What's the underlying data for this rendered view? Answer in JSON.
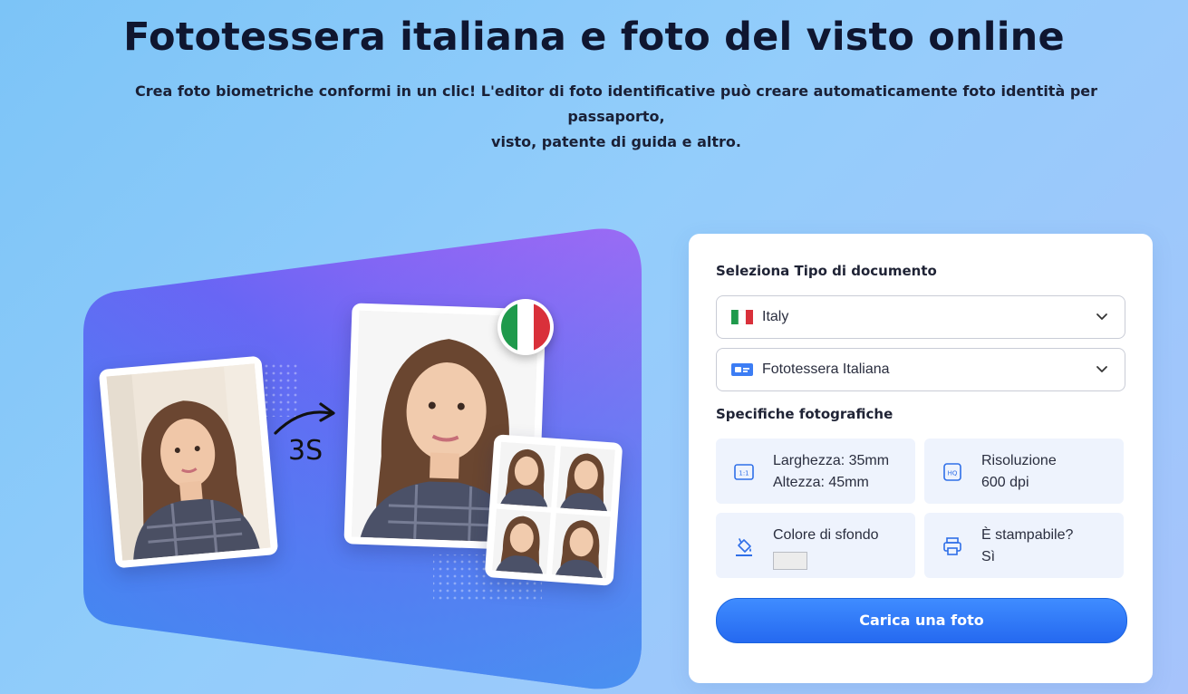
{
  "hero": {
    "title": "Fototessera italiana e foto del visto online",
    "subtitle_line1": "Crea foto biometriche conformi in un clic! L'editor di foto identificative può creare automaticamente foto identità per passaporto,",
    "subtitle_line2": "visto, patente di guida e altro."
  },
  "illustration": {
    "speed_label": "3S",
    "flag_icon": "italy-flag-icon",
    "colors": {
      "gradient_start": "#3d8df2",
      "gradient_mid": "#7b5df5",
      "gradient_end": "#c65ef7"
    }
  },
  "form": {
    "document_type_label": "Seleziona Tipo di documento",
    "country": {
      "value": "Italy",
      "icon": "italy-flag-icon"
    },
    "document": {
      "value": "Fototessera Italiana",
      "icon": "id-card-icon"
    },
    "specs_label": "Specifiche fotografiche",
    "specs": {
      "size": {
        "icon": "aspect-ratio-icon",
        "line1": "Larghezza: 35mm",
        "line2": "Altezza: 45mm"
      },
      "resolution": {
        "icon": "hq-icon",
        "line1": "Risoluzione",
        "line2": "600 dpi"
      },
      "background": {
        "icon": "paint-bucket-icon",
        "line1": "Colore di sfondo",
        "swatch_color": "#ececec"
      },
      "printable": {
        "icon": "printer-icon",
        "line1": "È stampabile?",
        "line2": "Sì"
      }
    },
    "upload_button": "Carica una foto"
  },
  "colors": {
    "accent": "#2f7bf7",
    "panel_bg": "#ffffff",
    "spec_bg": "#eef3fd"
  }
}
